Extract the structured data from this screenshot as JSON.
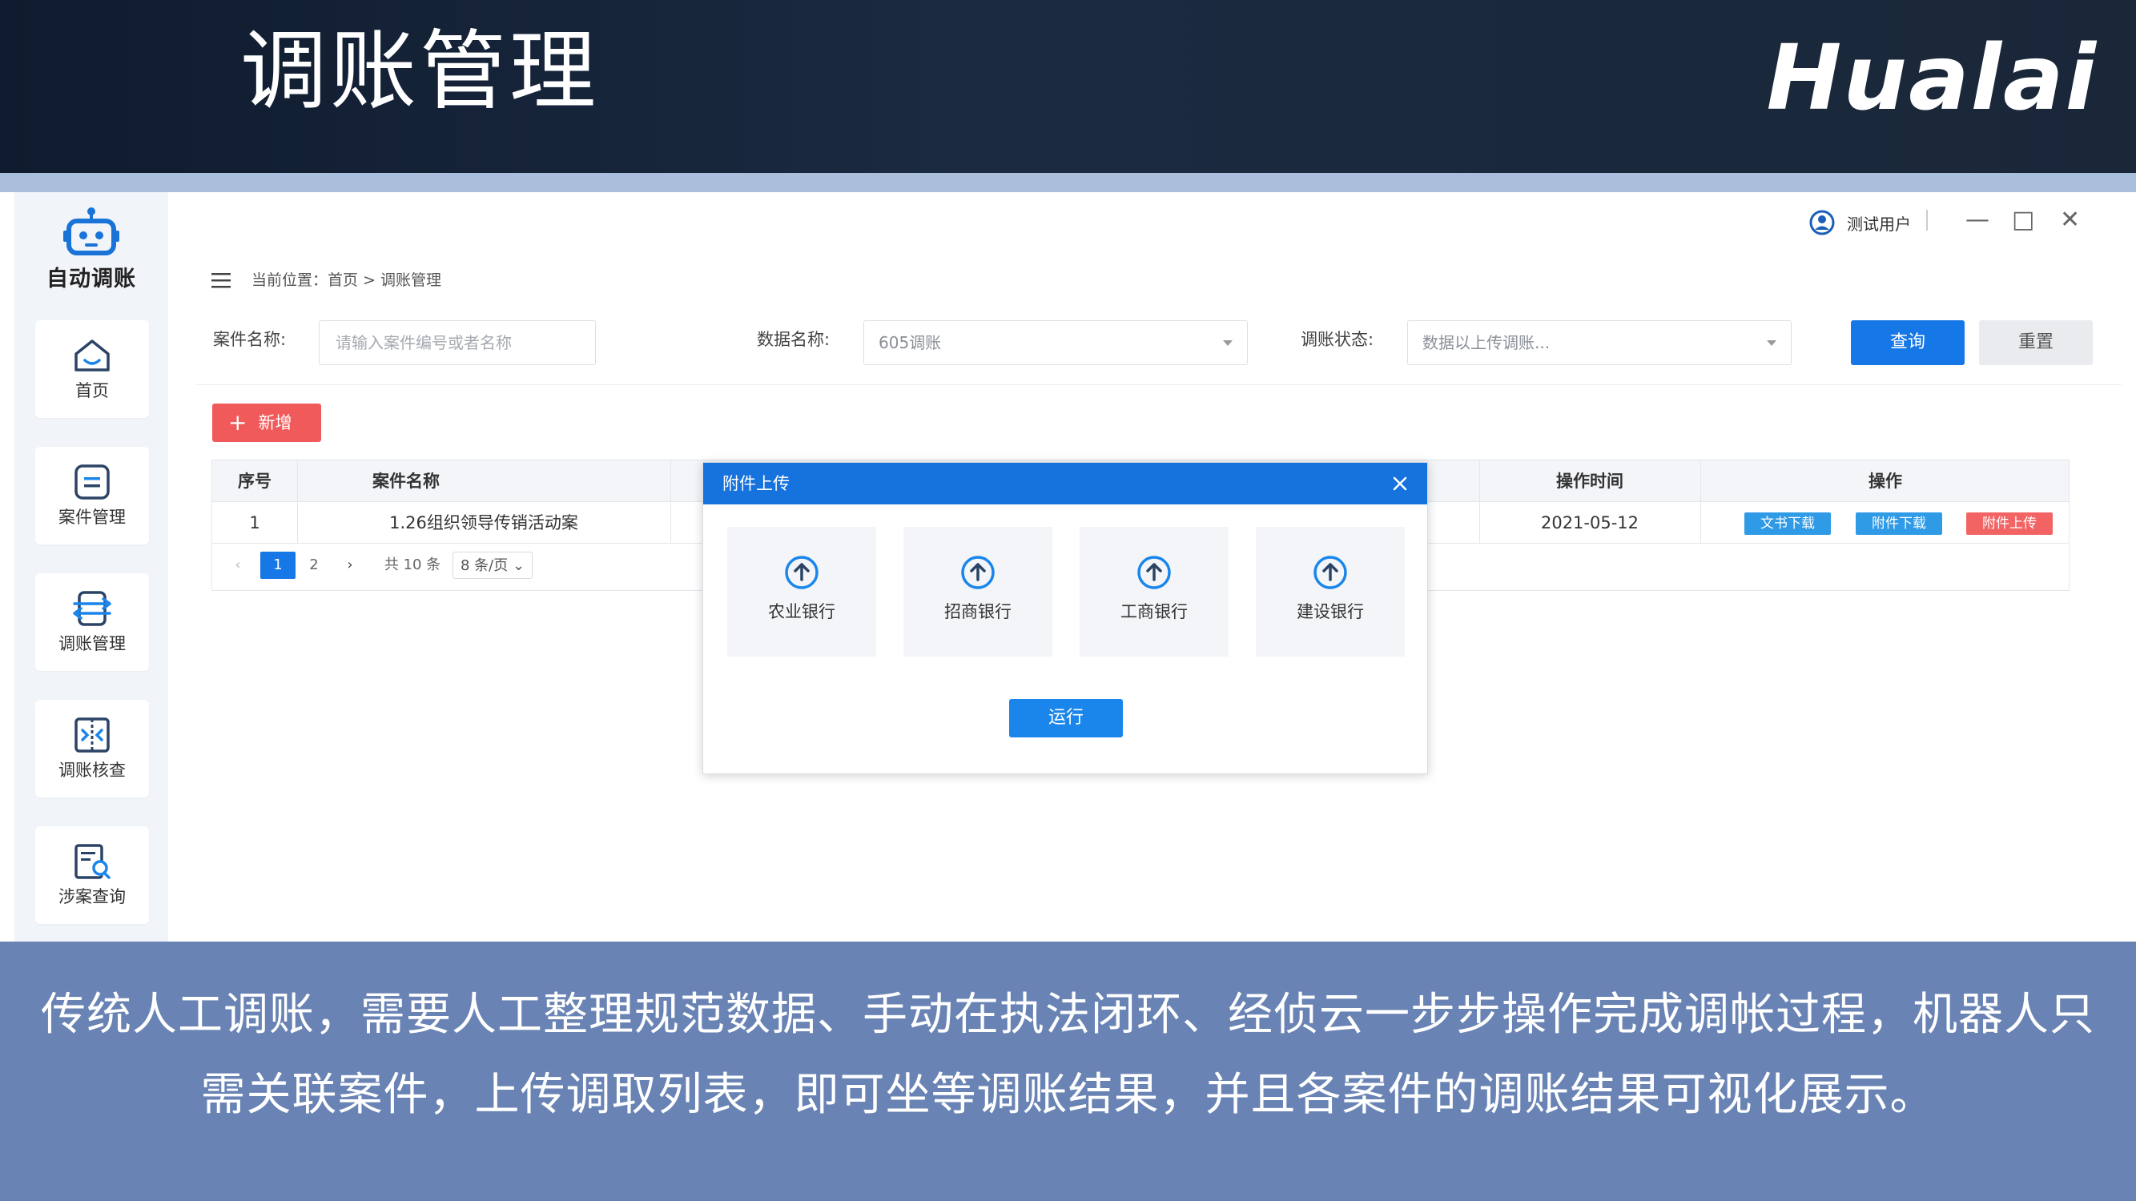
{
  "slide": {
    "title": "调账管理",
    "brand": "Hualai",
    "caption": "传统人工调账，需要人工整理规范数据、手动在执法闭环、经侦云一步步操作完成调帐过程，机器人只需关联案件，上传调取列表，即可坐等调账结果，并且各案件的调账结果可视化展示。"
  },
  "sidebar": {
    "brand_label": "自动调账",
    "items": [
      {
        "label": "首页",
        "icon": "home-icon"
      },
      {
        "label": "案件管理",
        "icon": "case-icon"
      },
      {
        "label": "调账管理",
        "icon": "transfer-icon"
      },
      {
        "label": "调账核查",
        "icon": "compare-icon"
      },
      {
        "label": "涉案查询",
        "icon": "search-doc-icon"
      }
    ]
  },
  "window": {
    "user": "测试用户",
    "minimize": "—",
    "maximize": "□",
    "close": "✕"
  },
  "breadcrumb": "当前位置：首页 > 调账管理",
  "filters": {
    "case_label": "案件名称:",
    "case_placeholder": "请输入案件编号或者名称",
    "data_label": "数据名称:",
    "data_value": "605调账",
    "status_label": "调账状态:",
    "status_value": "数据以上传调账..."
  },
  "buttons": {
    "query": "查询",
    "reset": "重置",
    "add": "新增",
    "run": "运行"
  },
  "table": {
    "headers": [
      "序号",
      "案件名称",
      "操作时间",
      "操作"
    ],
    "rows": [
      {
        "index": "1",
        "name": "1.26组织领导传销活动案",
        "time": "2021-05-12"
      }
    ],
    "actions": [
      "文书下载",
      "附件下载",
      "附件上传"
    ]
  },
  "pager": {
    "prev": "‹",
    "pages": [
      "1",
      "2"
    ],
    "next": "›",
    "total": "共 10 条",
    "size": "8 条/页"
  },
  "modal": {
    "title": "附件上传",
    "banks": [
      "农业银行",
      "招商银行",
      "工商银行",
      "建设银行"
    ]
  },
  "colors": {
    "primary": "#1677e6",
    "danger": "#f15a5a",
    "action_blue": "#2f9ae6",
    "action_red": "#f26464",
    "banner": "#14213a",
    "caption_bg": "#5c78ae"
  }
}
